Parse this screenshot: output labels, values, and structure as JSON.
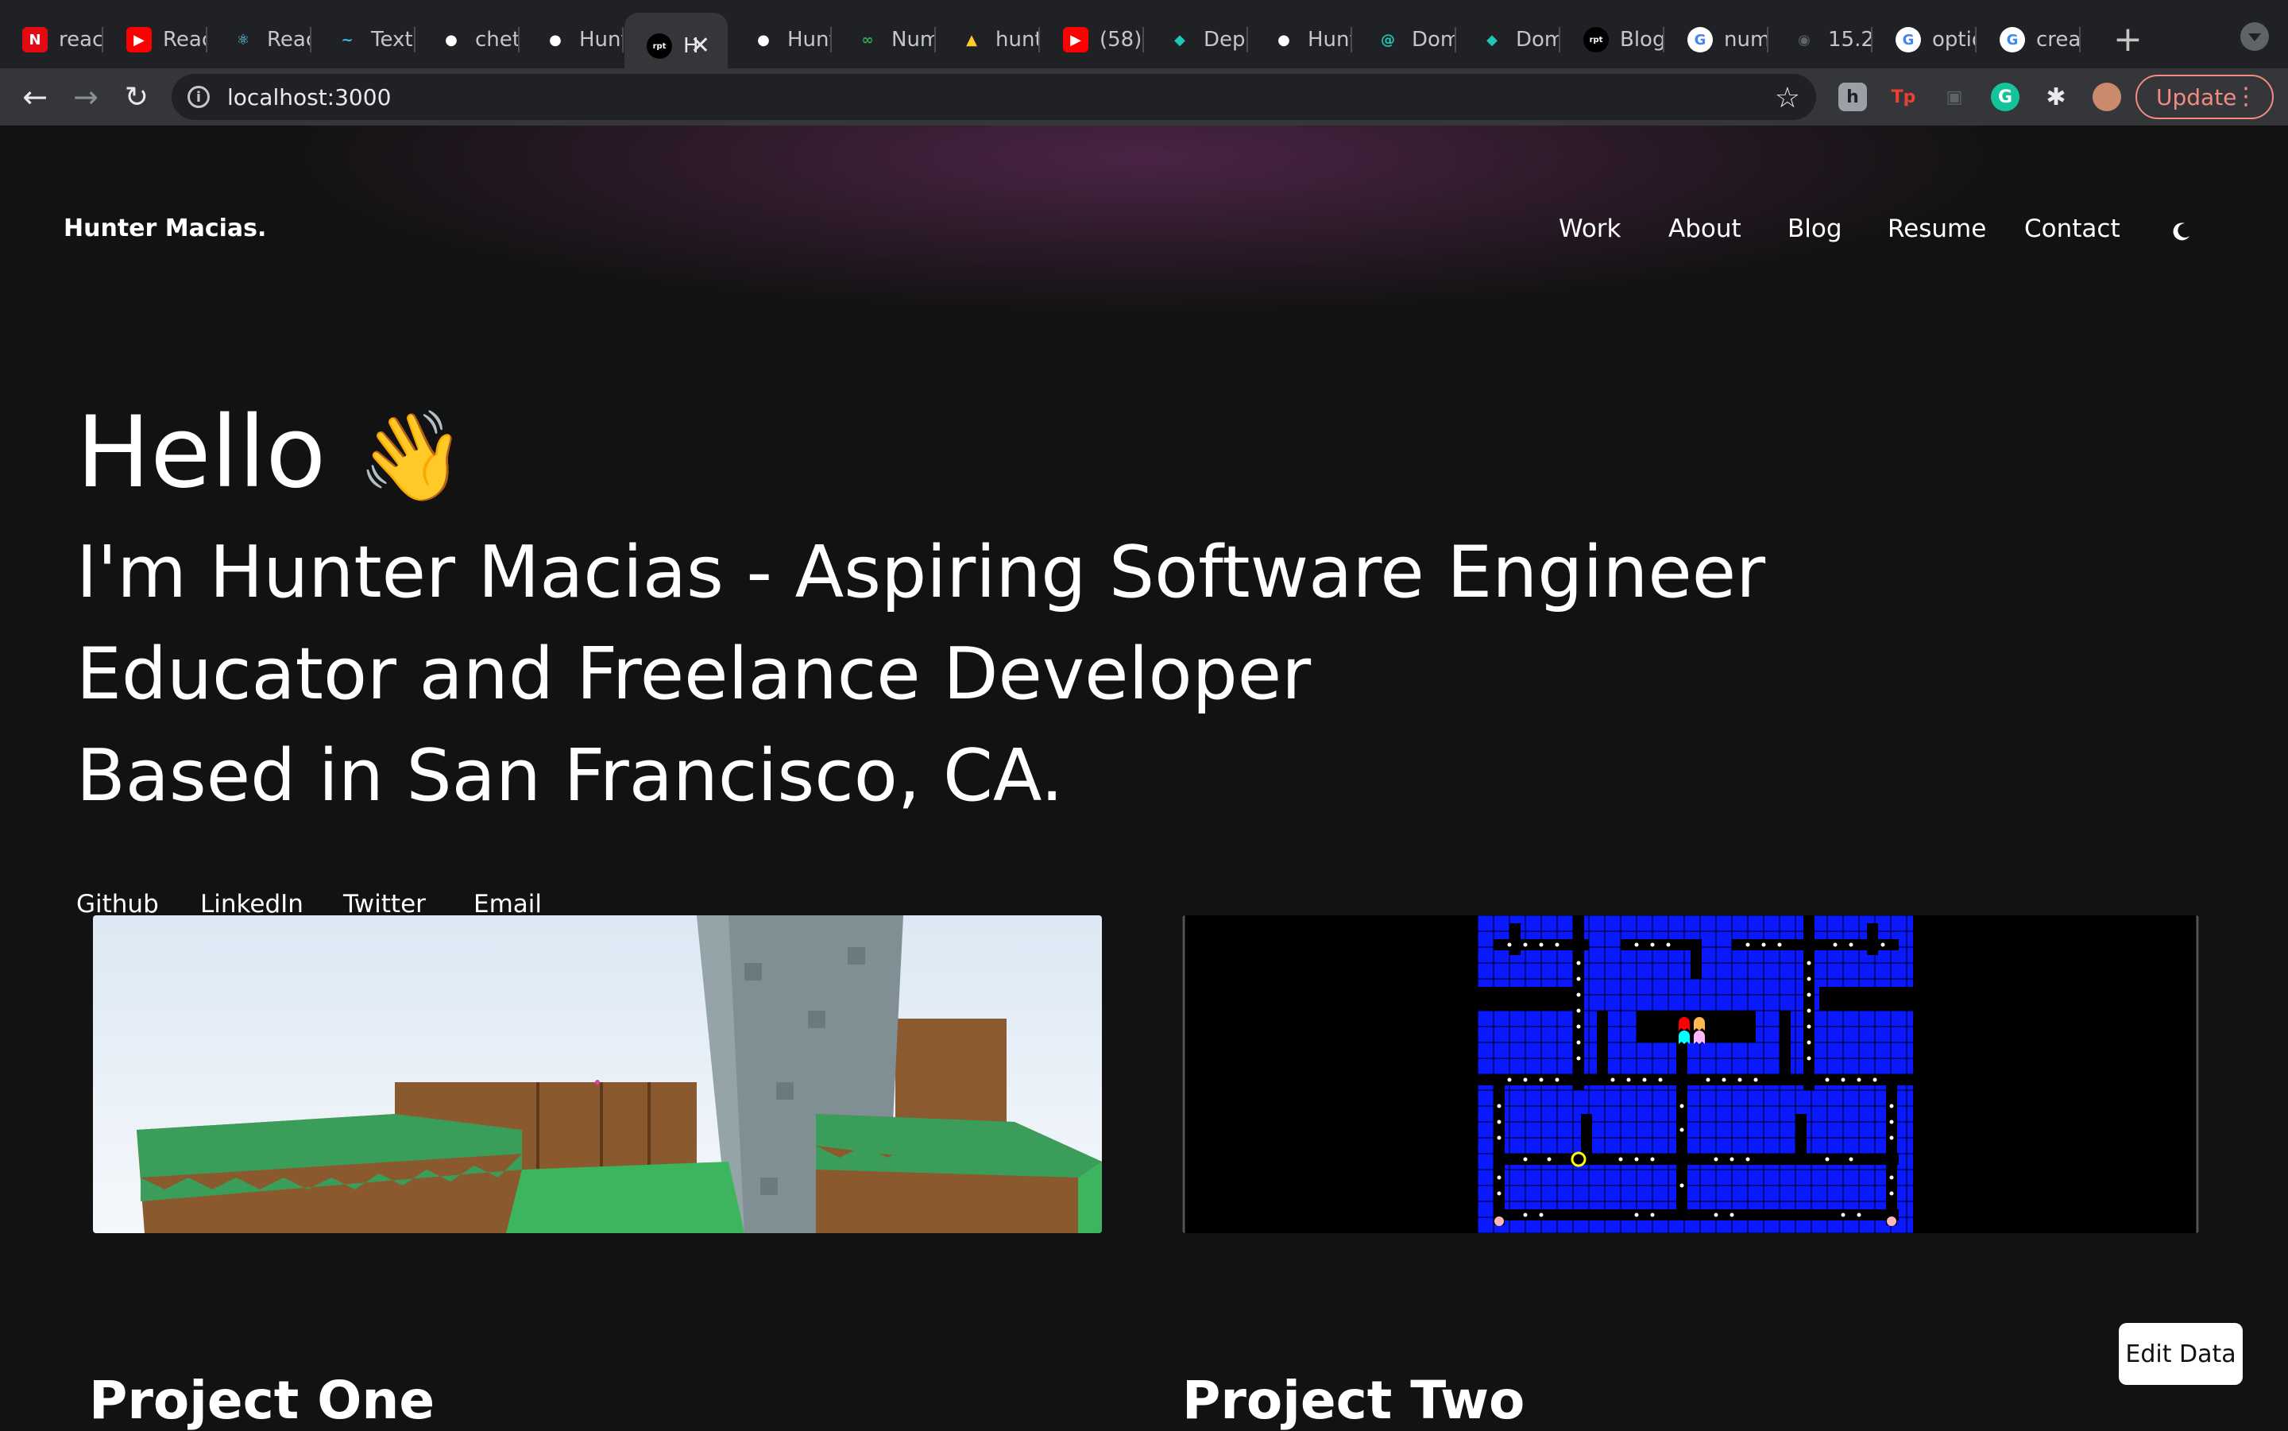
{
  "browser": {
    "tabs": [
      {
        "label": "reac",
        "icon": "netflix-icon",
        "color": "#e50914"
      },
      {
        "label": "Reac",
        "icon": "youtube-icon",
        "color": "#ff0000"
      },
      {
        "label": "Reac",
        "icon": "react-icon",
        "color": "#61dafb"
      },
      {
        "label": "Text",
        "icon": "tailwind-icon",
        "color": "#38bdf8"
      },
      {
        "label": "chet",
        "icon": "github-icon",
        "color": "#ffffff"
      },
      {
        "label": "Hunt",
        "icon": "github-icon",
        "color": "#ffffff"
      },
      {
        "label": "H",
        "icon": "site-icon",
        "color": "#000000",
        "active": true
      },
      {
        "label": "Hunt",
        "icon": "github-icon",
        "color": "#ffffff"
      },
      {
        "label": "Num",
        "icon": "infinity-icon",
        "color": "#34a853"
      },
      {
        "label": "hunt",
        "icon": "firebase-icon",
        "color": "#ffca28"
      },
      {
        "label": "(58)",
        "icon": "youtube-icon",
        "color": "#ff0000"
      },
      {
        "label": "Depl",
        "icon": "netlify-icon",
        "color": "#20c6b7"
      },
      {
        "label": "Hunt",
        "icon": "github-icon",
        "color": "#ffffff"
      },
      {
        "label": "Dom",
        "icon": "spiral-icon",
        "color": "#20c6b7"
      },
      {
        "label": "Dom",
        "icon": "netlify-icon",
        "color": "#20c6b7"
      },
      {
        "label": "Blog",
        "icon": "site-icon",
        "color": "#000000"
      },
      {
        "label": "num",
        "icon": "google-icon",
        "color": "#4285f4"
      },
      {
        "label": "15.2",
        "icon": "globe-icon",
        "color": "#5f6368"
      },
      {
        "label": "optio",
        "icon": "google-icon",
        "color": "#4285f4"
      },
      {
        "label": "crea",
        "icon": "google-icon",
        "color": "#4285f4"
      }
    ],
    "url": "localhost:3000",
    "update_label": "Update"
  },
  "site": {
    "logo": "Hunter Macias.",
    "nav": [
      "Work",
      "About",
      "Blog",
      "Resume",
      "Contact"
    ],
    "hello": "Hello",
    "wave": "👋",
    "intro": [
      "I'm Hunter Macias - Aspiring Software Engineer",
      "Educator and Freelance Developer",
      "Based in San Francisco, CA."
    ],
    "social": [
      "Github",
      "LinkedIn",
      "Twitter",
      "Email"
    ],
    "projects": [
      {
        "title": "Project One"
      },
      {
        "title": "Project Two"
      }
    ],
    "edit_button": "Edit Data"
  }
}
